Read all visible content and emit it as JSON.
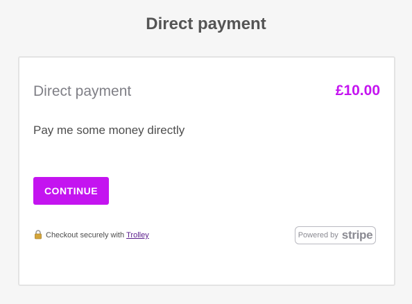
{
  "page": {
    "title": "Direct payment"
  },
  "product": {
    "name": "Direct payment",
    "price": "£10.00",
    "description": "Pay me some money directly"
  },
  "actions": {
    "continue_label": "CONTINUE"
  },
  "footer": {
    "secure_text": "Checkout securely with",
    "secure_link_text": "Trolley",
    "lock_icon": "lock-icon"
  },
  "badge": {
    "powered_by": "Powered by",
    "brand": "stripe"
  },
  "colors": {
    "accent": "#c414f0",
    "background": "#f6f6f6",
    "title": "#555555"
  }
}
